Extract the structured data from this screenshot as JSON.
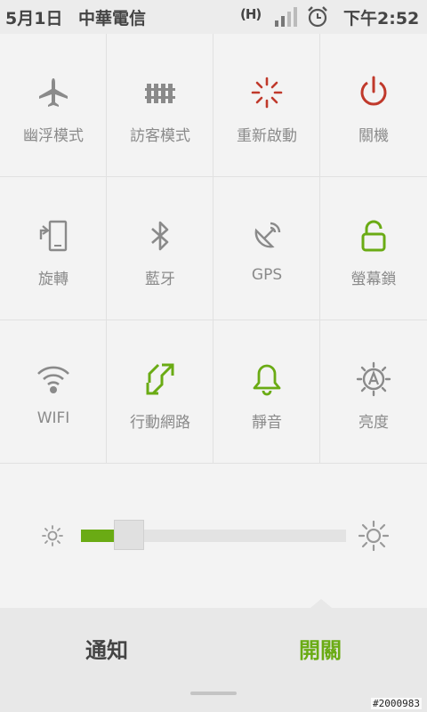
{
  "status_bar": {
    "date": "5月1日",
    "carrier": "中華電信",
    "network": "(H)",
    "time": "下午2:52",
    "icons": [
      "network-h-icon",
      "signal-icon",
      "alarm-icon"
    ]
  },
  "tiles": [
    {
      "label": "幽浮模式",
      "icon": "airplane-icon",
      "color": "#8a8a8a"
    },
    {
      "label": "訪客模式",
      "icon": "fence-icon",
      "color": "#8a8a8a"
    },
    {
      "label": "重新啟動",
      "icon": "restart-icon",
      "color": "#c0392b"
    },
    {
      "label": "關機",
      "icon": "power-icon",
      "color": "#c0392b"
    },
    {
      "label": "旋轉",
      "icon": "rotate-icon",
      "color": "#8a8a8a"
    },
    {
      "label": "藍牙",
      "icon": "bluetooth-icon",
      "color": "#8a8a8a"
    },
    {
      "label": "GPS",
      "icon": "gps-icon",
      "color": "#8a8a8a"
    },
    {
      "label": "螢幕鎖",
      "icon": "unlock-icon",
      "color": "#6aab14"
    },
    {
      "label": "WIFI",
      "icon": "wifi-icon",
      "color": "#8a8a8a"
    },
    {
      "label": "行動網路",
      "icon": "mobile-data-icon",
      "color": "#6aab14"
    },
    {
      "label": "靜音",
      "icon": "bell-icon",
      "color": "#6aab14"
    },
    {
      "label": "亮度",
      "icon": "auto-brightness-icon",
      "color": "#8a8a8a"
    }
  ],
  "brightness": {
    "level": 0.18,
    "fill_color": "#6aab14",
    "icons": [
      "brightness-low-icon",
      "brightness-high-icon"
    ]
  },
  "bottom_tabs": {
    "notifications": "通知",
    "switches": "開關",
    "active": "switches",
    "active_color": "#6aab14"
  },
  "watermark": "#2000983"
}
